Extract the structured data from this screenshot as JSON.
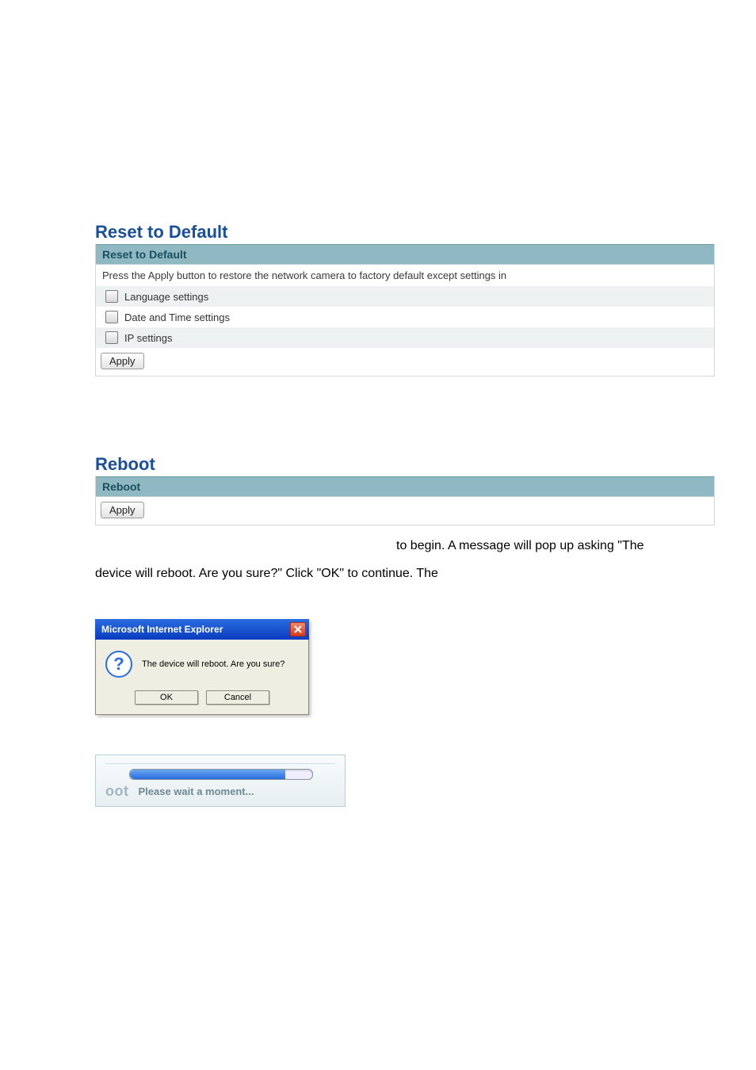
{
  "reset_panel": {
    "title": "Reset to Default",
    "header": "Reset to Default",
    "description": "Press the Apply button to restore the network camera to factory default except settings in",
    "options": [
      "Language settings",
      "Date and Time settings",
      "IP settings"
    ],
    "apply_label": "Apply"
  },
  "reboot_panel": {
    "title": "Reboot",
    "header": "Reboot",
    "apply_label": "Apply"
  },
  "body_text": {
    "line1": "to begin.    A message will pop up asking \"The",
    "line2": "device will reboot.    Are you sure?\"    Click \"OK\" to continue.    The"
  },
  "dialog": {
    "title": "Microsoft Internet Explorer",
    "message": "The device will reboot. Are you sure?",
    "ok": "OK",
    "cancel": "Cancel"
  },
  "progress": {
    "prefix": "oot",
    "text": "Please wait a moment..."
  }
}
